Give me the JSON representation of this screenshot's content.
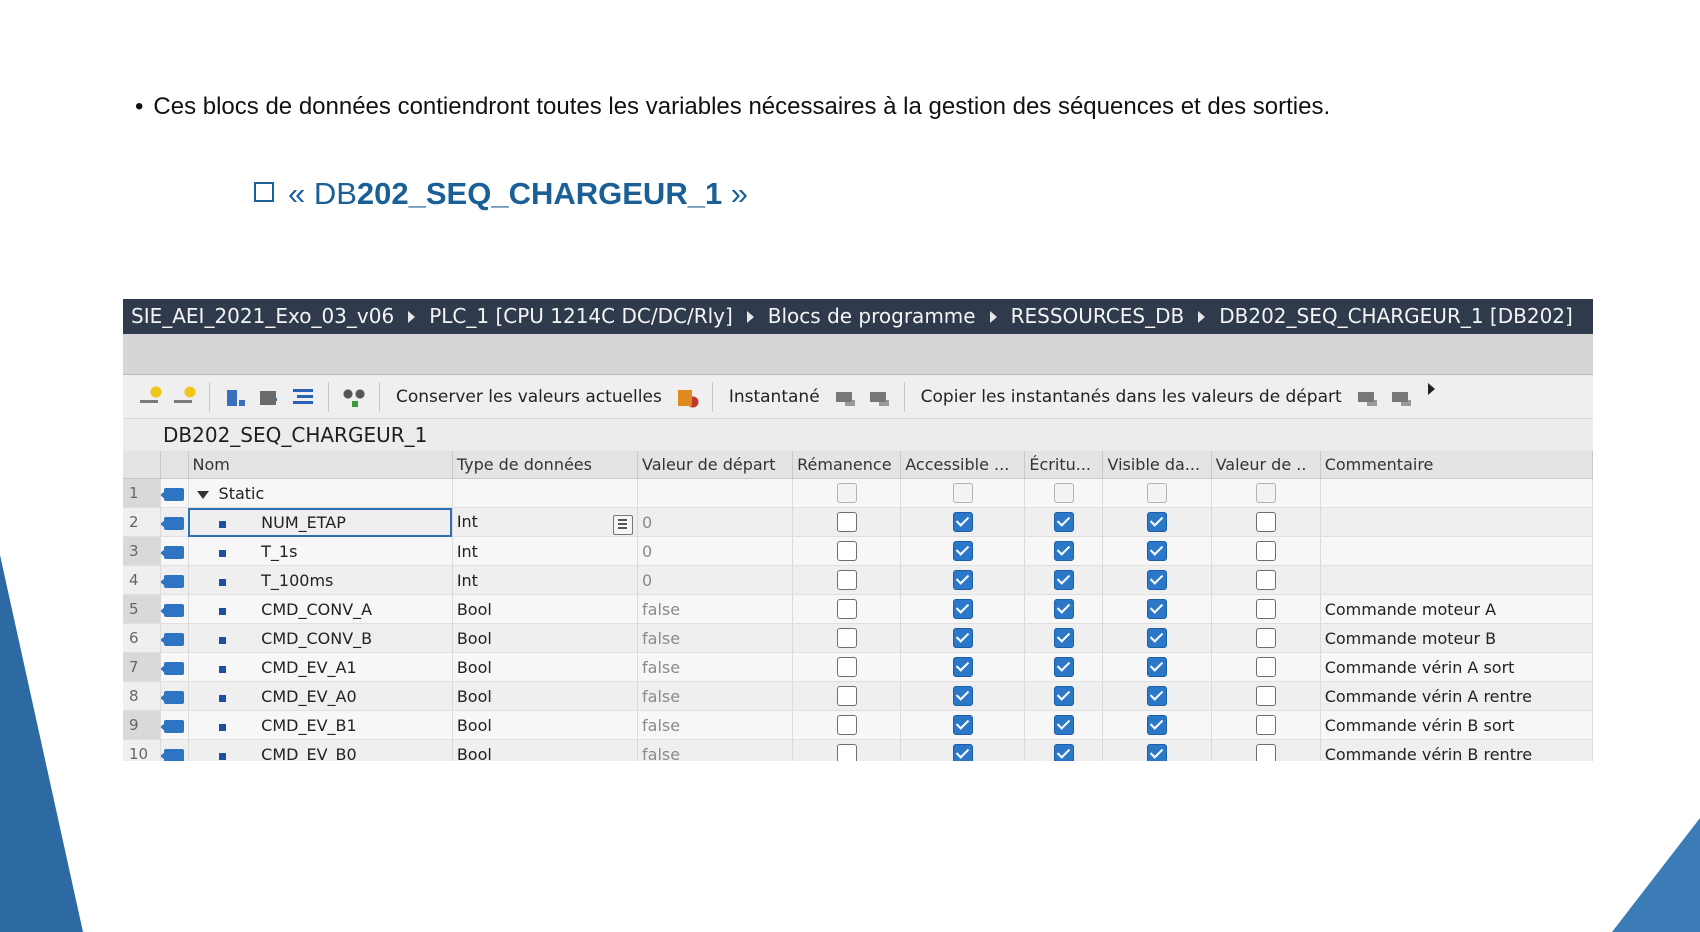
{
  "slide": {
    "bullet_marker": "•",
    "bullet_text": "Ces blocs de données contiendront toutes les variables nécessaires à la gestion des séquences et des sorties.",
    "heading_open": "« DB",
    "heading_bold": "202_SEQ_CHARGEUR_1",
    "heading_close": " »",
    "accent_color": "#1a5f95"
  },
  "breadcrumb": [
    "SIE_AEI_2021_Exo_03_v06",
    "PLC_1 [CPU 1214C DC/DC/Rly]",
    "Blocs de programme",
    "RESSOURCES_DB",
    "DB202_SEQ_CHARGEUR_1 [DB202]"
  ],
  "toolbar": {
    "keep_values_label": "Conserver les valeurs actuelles",
    "snapshot_label": "Instantané",
    "copy_snapshots_label": "Copier les instantanés dans les valeurs de départ"
  },
  "block_name": "DB202_SEQ_CHARGEUR_1",
  "table": {
    "headers": [
      "Nom",
      "Type de données",
      "Valeur de départ",
      "Rémanence",
      "Accessible ...",
      "Écritu...",
      "Visible da...",
      "Valeur de ..",
      "Commentaire"
    ],
    "rows": [
      {
        "num": "1",
        "name": "Static",
        "type": "",
        "start": "",
        "comment": ""
      },
      {
        "num": "2",
        "name": "NUM_ETAP",
        "type": "Int",
        "start": "0",
        "comment": ""
      },
      {
        "num": "3",
        "name": "T_1s",
        "type": "Int",
        "start": "0",
        "comment": ""
      },
      {
        "num": "4",
        "name": "T_100ms",
        "type": "Int",
        "start": "0",
        "comment": ""
      },
      {
        "num": "5",
        "name": "CMD_CONV_A",
        "type": "Bool",
        "start": "false",
        "comment": "Commande moteur A"
      },
      {
        "num": "6",
        "name": "CMD_CONV_B",
        "type": "Bool",
        "start": "false",
        "comment": "Commande moteur B"
      },
      {
        "num": "7",
        "name": "CMD_EV_A1",
        "type": "Bool",
        "start": "false",
        "comment": "Commande vérin A sort"
      },
      {
        "num": "8",
        "name": "CMD_EV_A0",
        "type": "Bool",
        "start": "false",
        "comment": "Commande vérin A rentre"
      },
      {
        "num": "9",
        "name": "CMD_EV_B1",
        "type": "Bool",
        "start": "false",
        "comment": "Commande vérin B sort"
      },
      {
        "num": "10",
        "name": "CMD_EV_B0",
        "type": "Bool",
        "start": "false",
        "comment": "Commande vérin B rentre"
      }
    ]
  }
}
